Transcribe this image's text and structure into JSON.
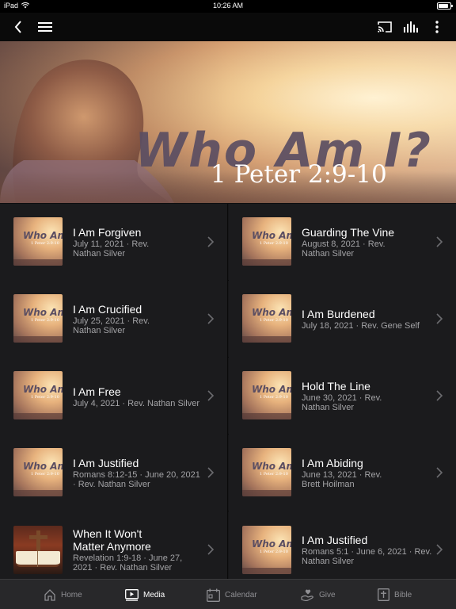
{
  "status_bar": {
    "device": "iPad",
    "time": "10:26 AM",
    "battery_level": 0.85
  },
  "nav": {
    "back_icon": "chevron-left-icon",
    "menu_icon": "hamburger-menu-icon",
    "cast_icon": "cast-icon",
    "audio_icon": "audio-bars-icon",
    "more_icon": "more-vertical-icon"
  },
  "hero": {
    "title": "Who Am I?",
    "reference": "1 Peter 2:9-10"
  },
  "thumbnail": {
    "title": "Who Am I?",
    "reference": "1 Peter 2:9-10"
  },
  "sermons": [
    {
      "title": "I Am Forgiven",
      "meta": [
        "July 11, 2021 · Rev.",
        "Nathan Silver"
      ],
      "thumb": "series"
    },
    {
      "title": "Guarding The Vine",
      "meta": [
        "August 8, 2021 · Rev.",
        "Nathan Silver"
      ],
      "thumb": "series"
    },
    {
      "title": "I Am Crucified",
      "meta": [
        "July 25, 2021 · Rev.",
        "Nathan Silver"
      ],
      "thumb": "series"
    },
    {
      "title": "I Am Burdened",
      "meta": [
        "July 18, 2021 · Rev. Gene Self"
      ],
      "thumb": "series"
    },
    {
      "title": "I Am Free",
      "meta": [
        "July 4, 2021 · Rev. Nathan Silver"
      ],
      "thumb": "series"
    },
    {
      "title": "Hold The Line",
      "meta": [
        "June 30, 2021 · Rev.",
        "Nathan Silver"
      ],
      "thumb": "series"
    },
    {
      "title": "I Am Justified",
      "meta": [
        "Romans 8:12-15 · June 20, 2021",
        "· Rev. Nathan Silver"
      ],
      "thumb": "series"
    },
    {
      "title": "I Am Abiding",
      "meta": [
        "June 13, 2021 · Rev.",
        "Brett Hoilman"
      ],
      "thumb": "series"
    },
    {
      "title_lines": [
        "When It Won't",
        "Matter Anymore"
      ],
      "meta": [
        "Revelation 1:9-18 · June 27,",
        "2021 · Rev. Nathan Silver"
      ],
      "thumb": "bible"
    },
    {
      "title": "I Am Justified",
      "meta": [
        "Romans 5:1 · June 6, 2021 · Rev.",
        "Nathan Silver"
      ],
      "thumb": "series"
    }
  ],
  "tabs": [
    {
      "label": "Home",
      "icon": "home-icon",
      "active": false
    },
    {
      "label": "Media",
      "icon": "media-play-icon",
      "active": true
    },
    {
      "label": "Calendar",
      "icon": "calendar-icon",
      "active": false
    },
    {
      "label": "Give",
      "icon": "give-hand-icon",
      "active": false
    },
    {
      "label": "Bible",
      "icon": "bible-icon",
      "active": false
    }
  ]
}
